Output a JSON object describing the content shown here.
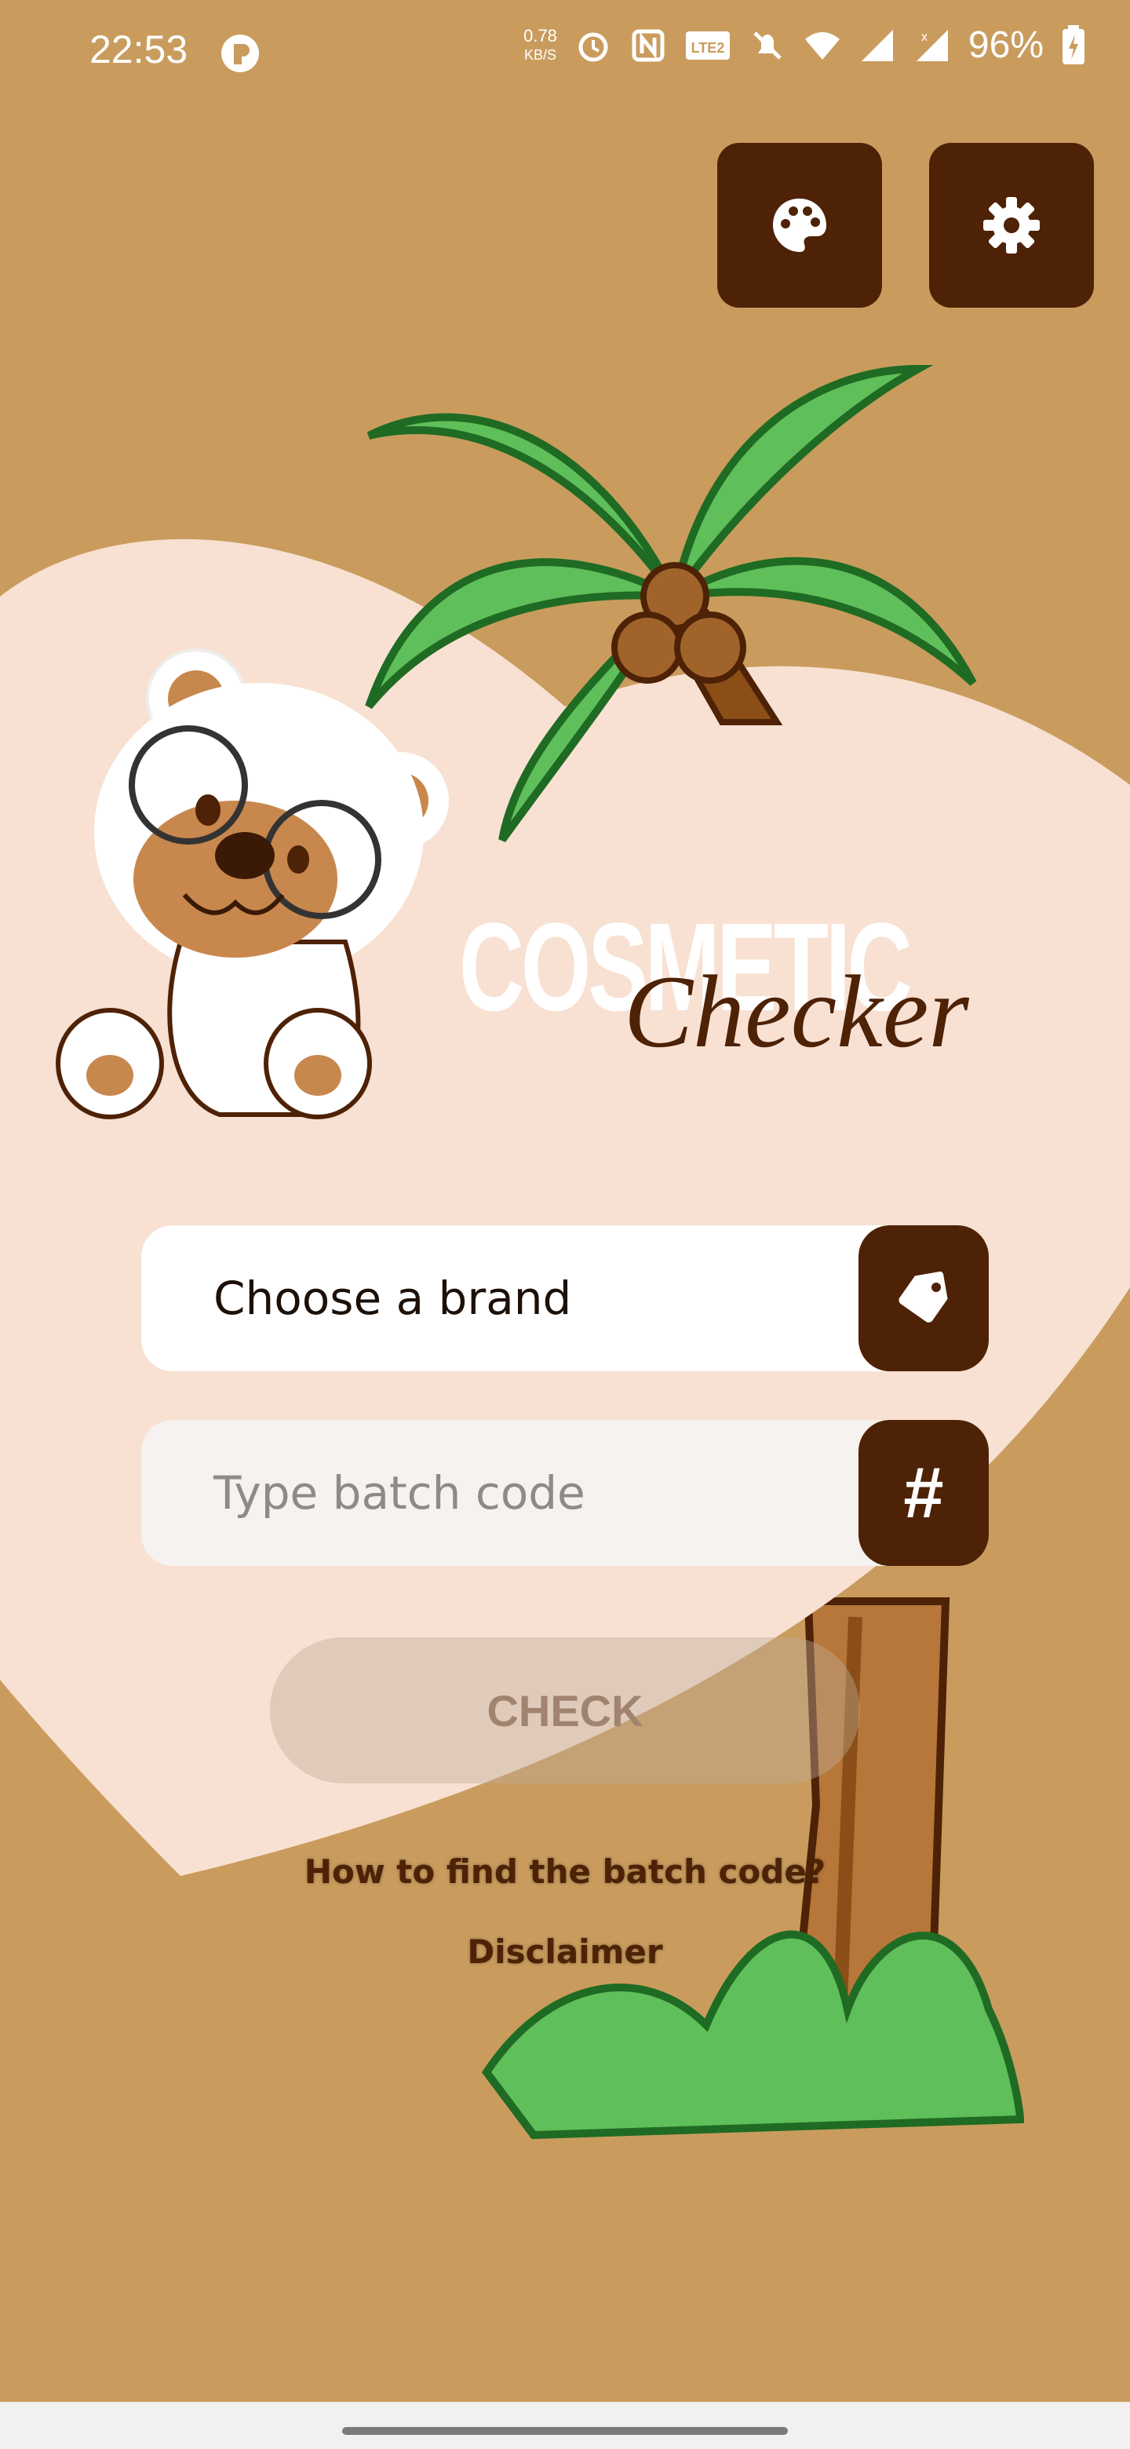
{
  "status_bar": {
    "time": "22:53",
    "net_speed_value": "0.78",
    "net_speed_unit": "KB/S",
    "battery": "96%",
    "icons": [
      "app-notification-icon",
      "alarm-icon",
      "nfc-icon",
      "volte-icon",
      "silent-icon",
      "wifi-icon",
      "signal-icon",
      "signal-x-icon",
      "battery-charging-icon"
    ]
  },
  "toolbar": {
    "icons": [
      "palette-icon",
      "settings-gear-icon"
    ]
  },
  "logo": {
    "word": "COSMETIC",
    "script": "Checker"
  },
  "form": {
    "brand_label": "Choose a brand",
    "brand_icon": "tag-icon",
    "batch_placeholder": "Type batch code",
    "batch_icon": "#",
    "check_label": "CHECK"
  },
  "links": {
    "batch_help": "How to find the batch code?",
    "disclaimer": "Disclaimer"
  },
  "colors": {
    "background": "#c99c5e",
    "accent_dark_brown": "#4e2206",
    "heart": "#f8e1d2",
    "leaf_green": "#5fbf5a"
  }
}
